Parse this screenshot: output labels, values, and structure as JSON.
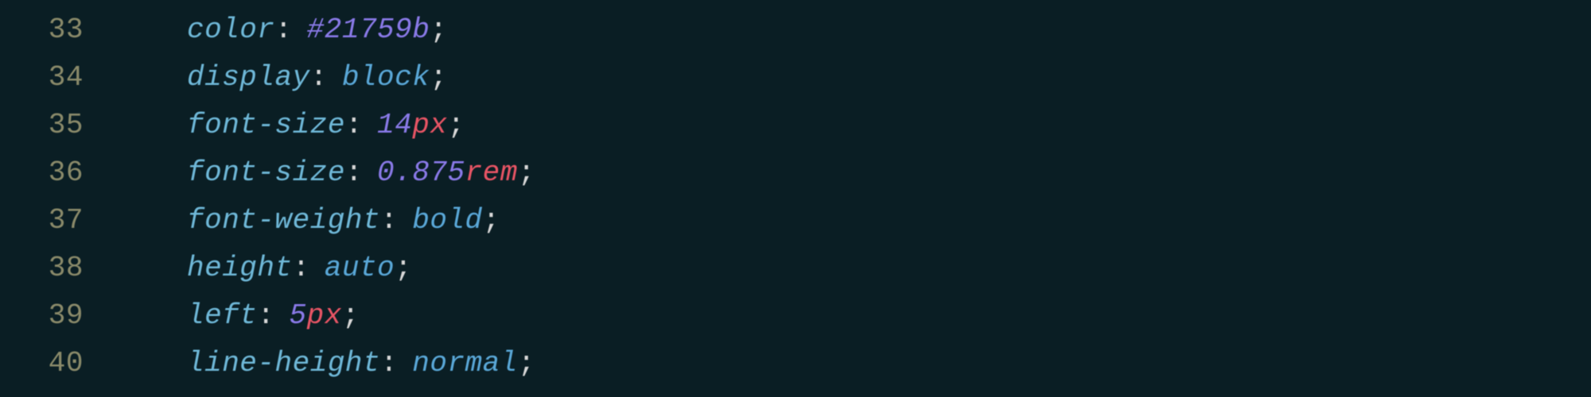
{
  "editor": {
    "lines": [
      {
        "number": "33",
        "property": "color",
        "colon": ":",
        "segments": [
          {
            "text": "#21759b",
            "class": "value-hex"
          }
        ],
        "semicolon": ";"
      },
      {
        "number": "34",
        "property": "display",
        "colon": ":",
        "segments": [
          {
            "text": "block",
            "class": "value-keyword"
          }
        ],
        "semicolon": ";"
      },
      {
        "number": "35",
        "property": "font-size",
        "colon": ":",
        "segments": [
          {
            "text": "14",
            "class": "value-number"
          },
          {
            "text": "px",
            "class": "value-unit"
          }
        ],
        "semicolon": ";"
      },
      {
        "number": "36",
        "property": "font-size",
        "colon": ":",
        "segments": [
          {
            "text": "0.875",
            "class": "value-number"
          },
          {
            "text": "rem",
            "class": "value-unit"
          }
        ],
        "semicolon": ";"
      },
      {
        "number": "37",
        "property": "font-weight",
        "colon": ":",
        "segments": [
          {
            "text": "bold",
            "class": "value-keyword"
          }
        ],
        "semicolon": ";"
      },
      {
        "number": "38",
        "property": "height",
        "colon": ":",
        "segments": [
          {
            "text": "auto",
            "class": "value-keyword"
          }
        ],
        "semicolon": ";"
      },
      {
        "number": "39",
        "property": "left",
        "colon": ":",
        "segments": [
          {
            "text": "5",
            "class": "value-number"
          },
          {
            "text": "px",
            "class": "value-unit"
          }
        ],
        "semicolon": ";"
      },
      {
        "number": "40",
        "property": "line-height",
        "colon": ":",
        "segments": [
          {
            "text": "normal",
            "class": "value-keyword"
          }
        ],
        "semicolon": ";"
      }
    ]
  }
}
